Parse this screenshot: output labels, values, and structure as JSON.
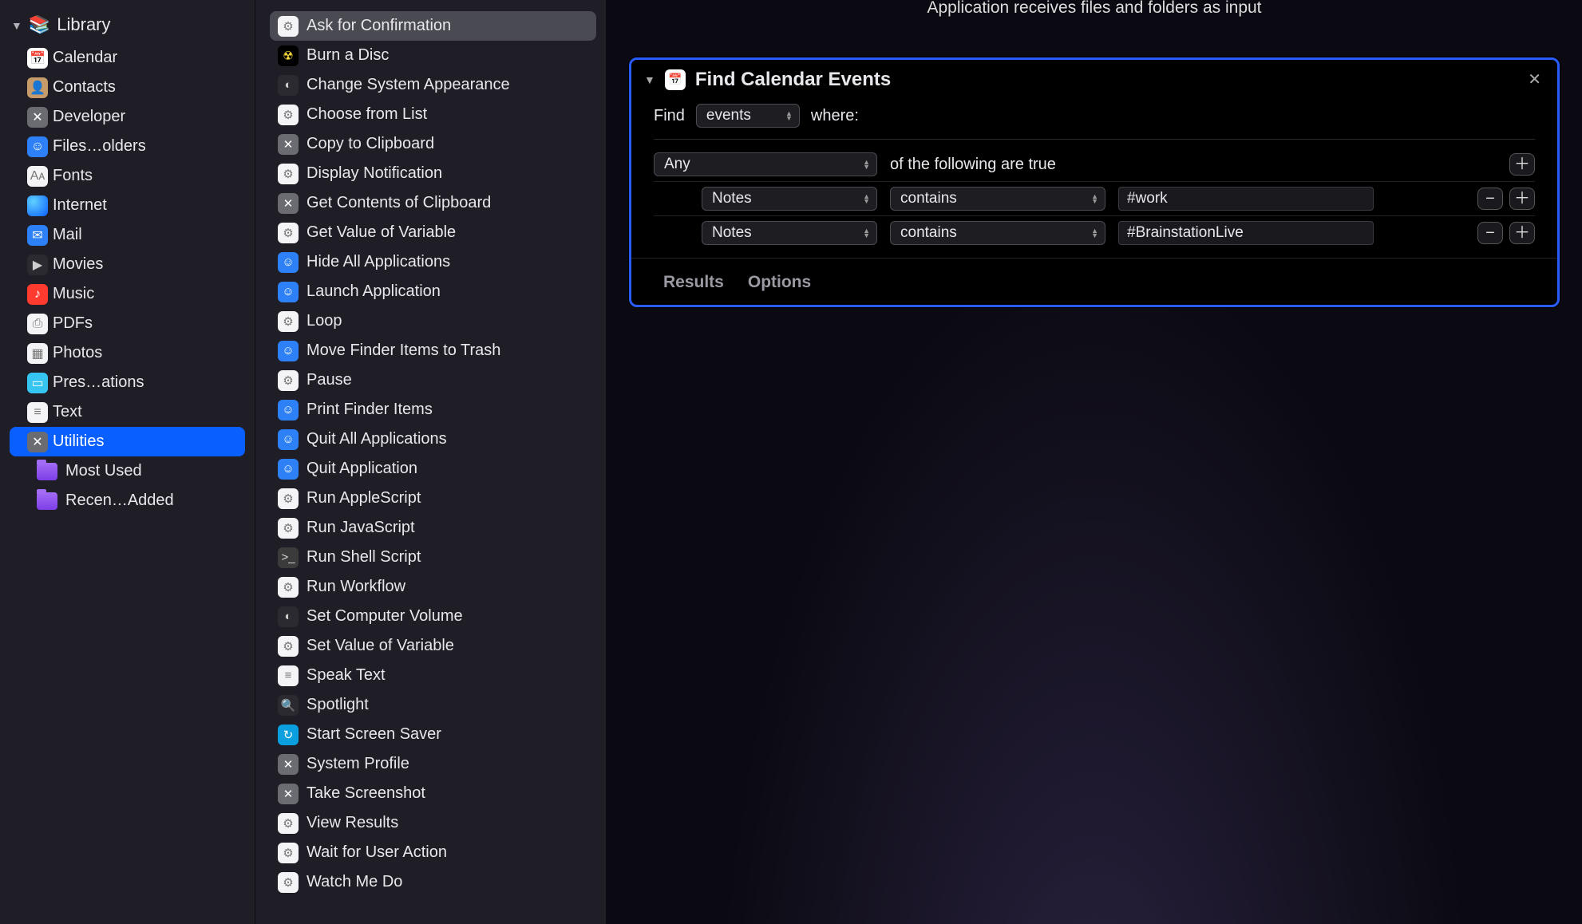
{
  "library": {
    "title": "Library",
    "items": [
      {
        "label": "Calendar",
        "icon": "📅",
        "cls": "bg-white",
        "name": "sidebar-item-calendar"
      },
      {
        "label": "Contacts",
        "icon": "👤",
        "cls": "bg-tan",
        "name": "sidebar-item-contacts"
      },
      {
        "label": "Developer",
        "icon": "✕",
        "cls": "bg-grey",
        "name": "sidebar-item-developer"
      },
      {
        "label": "Files…olders",
        "icon": "☺",
        "cls": "bg-blue",
        "name": "sidebar-item-files-folders"
      },
      {
        "label": "Fonts",
        "icon": "Aᴀ",
        "cls": "bg-white2",
        "name": "sidebar-item-fonts"
      },
      {
        "label": "Internet",
        "icon": "",
        "cls": "bg-globe",
        "name": "sidebar-item-internet"
      },
      {
        "label": "Mail",
        "icon": "✉",
        "cls": "bg-blue",
        "name": "sidebar-item-mail"
      },
      {
        "label": "Movies",
        "icon": "▶",
        "cls": "bg-dark",
        "name": "sidebar-item-movies"
      },
      {
        "label": "Music",
        "icon": "♪",
        "cls": "bg-red",
        "name": "sidebar-item-music"
      },
      {
        "label": "PDFs",
        "icon": "⎙",
        "cls": "bg-white2",
        "name": "sidebar-item-pdfs"
      },
      {
        "label": "Photos",
        "icon": "▦",
        "cls": "bg-white2",
        "name": "sidebar-item-photos"
      },
      {
        "label": "Pres…ations",
        "icon": "▭",
        "cls": "bg-aqua",
        "name": "sidebar-item-presentations"
      },
      {
        "label": "Text",
        "icon": "≡",
        "cls": "bg-white2",
        "name": "sidebar-item-text"
      },
      {
        "label": "Utilities",
        "icon": "✕",
        "cls": "bg-grey",
        "name": "sidebar-item-utilities",
        "selected": true
      }
    ],
    "folders": [
      {
        "label": "Most Used",
        "name": "sidebar-folder-most-used"
      },
      {
        "label": "Recen…Added",
        "name": "sidebar-folder-recently-added"
      }
    ]
  },
  "actions": [
    {
      "label": "Ask for Confirmation",
      "icon": "⚙",
      "cls": "bg-white2",
      "name": "action-ask-for-confirmation",
      "selected": true
    },
    {
      "label": "Burn a Disc",
      "icon": "☢",
      "cls": "bg-yellow",
      "name": "action-burn-a-disc"
    },
    {
      "label": "Change System Appearance",
      "icon": "◐",
      "cls": "bg-dark",
      "name": "action-change-system-appearance"
    },
    {
      "label": "Choose from List",
      "icon": "⚙",
      "cls": "bg-white2",
      "name": "action-choose-from-list"
    },
    {
      "label": "Copy to Clipboard",
      "icon": "✕",
      "cls": "bg-grey",
      "name": "action-copy-to-clipboard"
    },
    {
      "label": "Display Notification",
      "icon": "⚙",
      "cls": "bg-white2",
      "name": "action-display-notification"
    },
    {
      "label": "Get Contents of Clipboard",
      "icon": "✕",
      "cls": "bg-grey",
      "name": "action-get-contents-of-clipboard"
    },
    {
      "label": "Get Value of Variable",
      "icon": "⚙",
      "cls": "bg-white2",
      "name": "action-get-value-of-variable"
    },
    {
      "label": "Hide All Applications",
      "icon": "☺",
      "cls": "bg-blue",
      "name": "action-hide-all-applications"
    },
    {
      "label": "Launch Application",
      "icon": "☺",
      "cls": "bg-blue",
      "name": "action-launch-application"
    },
    {
      "label": "Loop",
      "icon": "⚙",
      "cls": "bg-white2",
      "name": "action-loop"
    },
    {
      "label": "Move Finder Items to Trash",
      "icon": "☺",
      "cls": "bg-blue",
      "name": "action-move-finder-items-to-trash"
    },
    {
      "label": "Pause",
      "icon": "⚙",
      "cls": "bg-white2",
      "name": "action-pause"
    },
    {
      "label": "Print Finder Items",
      "icon": "☺",
      "cls": "bg-blue",
      "name": "action-print-finder-items"
    },
    {
      "label": "Quit All Applications",
      "icon": "☺",
      "cls": "bg-blue",
      "name": "action-quit-all-applications"
    },
    {
      "label": "Quit Application",
      "icon": "☺",
      "cls": "bg-blue",
      "name": "action-quit-application"
    },
    {
      "label": "Run AppleScript",
      "icon": "⚙",
      "cls": "bg-white2",
      "name": "action-run-applescript"
    },
    {
      "label": "Run JavaScript",
      "icon": "⚙",
      "cls": "bg-white2",
      "name": "action-run-javascript"
    },
    {
      "label": "Run Shell Script",
      "icon": ">_",
      "cls": "bg-green",
      "name": "action-run-shell-script"
    },
    {
      "label": "Run Workflow",
      "icon": "⚙",
      "cls": "bg-white2",
      "name": "action-run-workflow"
    },
    {
      "label": "Set Computer Volume",
      "icon": "◐",
      "cls": "bg-dark",
      "name": "action-set-computer-volume"
    },
    {
      "label": "Set Value of Variable",
      "icon": "⚙",
      "cls": "bg-white2",
      "name": "action-set-value-of-variable"
    },
    {
      "label": "Speak Text",
      "icon": "≡",
      "cls": "bg-white2",
      "name": "action-speak-text"
    },
    {
      "label": "Spotlight",
      "icon": "🔍",
      "cls": "bg-dark",
      "name": "action-spotlight"
    },
    {
      "label": "Start Screen Saver",
      "icon": "↻",
      "cls": "bg-cyan",
      "name": "action-start-screen-saver"
    },
    {
      "label": "System Profile",
      "icon": "✕",
      "cls": "bg-grey",
      "name": "action-system-profile"
    },
    {
      "label": "Take Screenshot",
      "icon": "✕",
      "cls": "bg-grey",
      "name": "action-take-screenshot"
    },
    {
      "label": "View Results",
      "icon": "⚙",
      "cls": "bg-white2",
      "name": "action-view-results"
    },
    {
      "label": "Wait for User Action",
      "icon": "⚙",
      "cls": "bg-white2",
      "name": "action-wait-for-user-action"
    },
    {
      "label": "Watch Me Do",
      "icon": "⚙",
      "cls": "bg-white2",
      "name": "action-watch-me-do"
    }
  ],
  "workflow": {
    "banner": "Application receives files and folders as input",
    "card": {
      "title": "Find Calendar Events",
      "find_label": "Find",
      "find_select": "events",
      "where_label": "where:",
      "match_select": "Any",
      "match_suffix": "of the following are true",
      "rules": [
        {
          "field": "Notes",
          "op": "contains",
          "value": "#work"
        },
        {
          "field": "Notes",
          "op": "contains",
          "value": "#BrainstationLive"
        }
      ],
      "tabs": {
        "results": "Results",
        "options": "Options"
      }
    }
  }
}
